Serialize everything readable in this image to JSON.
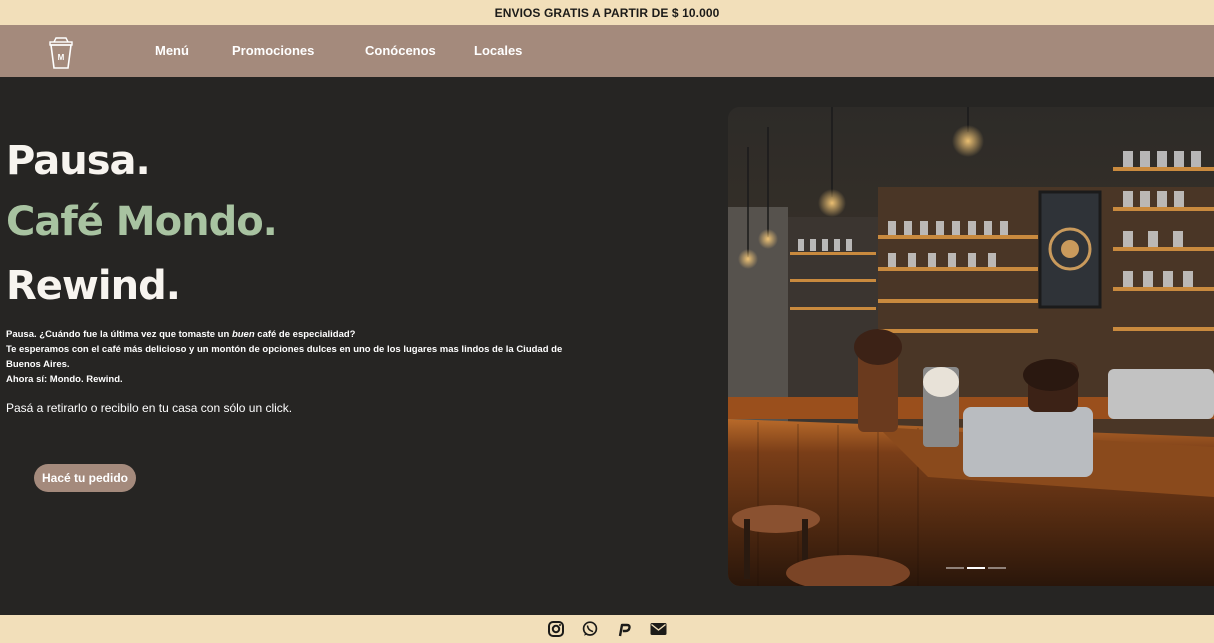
{
  "topbar": {
    "text": "ENVIOS GRATIS A PARTIR DE $ 10.000"
  },
  "nav": {
    "logo_letter": "M",
    "items": [
      "Menú",
      "Promociones",
      "Conócenos",
      "Locales"
    ]
  },
  "hero": {
    "line1": "Pausa.",
    "line2": "Café Mondo.",
    "line3": "Rewind.",
    "desc_part1": "Pausa. ¿Cuándo fue la última vez que tomaste un ",
    "desc_em": "buen",
    "desc_part2": " café de especialidad?",
    "desc_line2": "Te esperamos con el café más delicioso y un montón de opciones dulces en uno de los lugares mas lindos de la Ciudad de Buenos Aires.",
    "desc_line3": "Ahora sí: Mondo. Rewind.",
    "cta_text": "Pasá a retirarlo o recibilo en tu casa con sólo un click.",
    "button": "Hacé tu pedido"
  },
  "carousel": {
    "slide_count": 3,
    "active_slide": 2
  },
  "footer": {
    "icons": [
      "instagram-icon",
      "whatsapp-icon",
      "pedidosya-icon",
      "mail-icon"
    ]
  },
  "colors": {
    "background": "#262523",
    "topbar": "#f2dfba",
    "nav": "#a48a7c",
    "accent_green": "#a8c3a1"
  }
}
